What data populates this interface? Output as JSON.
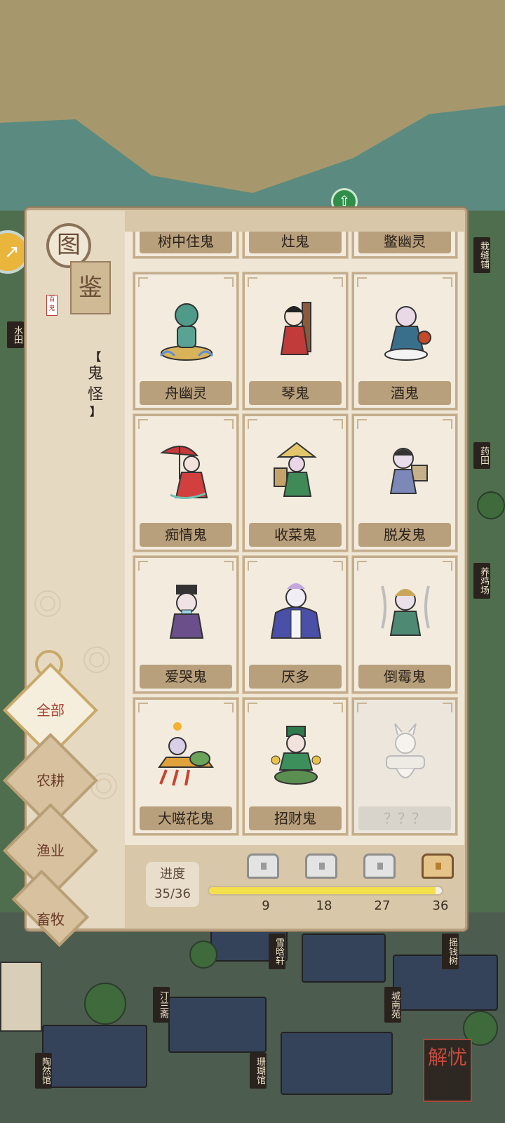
{
  "map": {
    "labels": [
      "栽缝铺",
      "水田",
      "药田",
      "养鸡场",
      "雪晗轩",
      "摇钱树",
      "汀兰斋",
      "城南苑",
      "陶然馆",
      "珊瑚馆"
    ],
    "solve_button": "解忧"
  },
  "codex": {
    "title_top": "图",
    "title_bottom": "鉴",
    "seal": "百鬼",
    "category": "鬼怪",
    "bracket_open": "【",
    "bracket_close": "】"
  },
  "tabs": [
    {
      "label": "全部",
      "active": true
    },
    {
      "label": "农耕",
      "active": false
    },
    {
      "label": "渔业",
      "active": false
    },
    {
      "label": "畜牧",
      "active": false
    }
  ],
  "top_row": [
    "树中住鬼",
    "灶鬼",
    "鳖幽灵"
  ],
  "cards": [
    {
      "name": "舟幽灵",
      "locked": false
    },
    {
      "name": "琴鬼",
      "locked": false
    },
    {
      "name": "酒鬼",
      "locked": false
    },
    {
      "name": "痴情鬼",
      "locked": false
    },
    {
      "name": "收菜鬼",
      "locked": false
    },
    {
      "name": "脱发鬼",
      "locked": false
    },
    {
      "name": "爱哭鬼",
      "locked": false
    },
    {
      "name": "厌多",
      "locked": false
    },
    {
      "name": "倒霉鬼",
      "locked": false
    },
    {
      "name": "大嗞花鬼",
      "locked": false
    },
    {
      "name": "招财鬼",
      "locked": false
    },
    {
      "name": "？？？",
      "locked": true
    }
  ],
  "progress": {
    "label": "进度",
    "text": "35/36",
    "current": 35,
    "total": 36,
    "milestones": [
      "9",
      "18",
      "27",
      "36"
    ]
  }
}
